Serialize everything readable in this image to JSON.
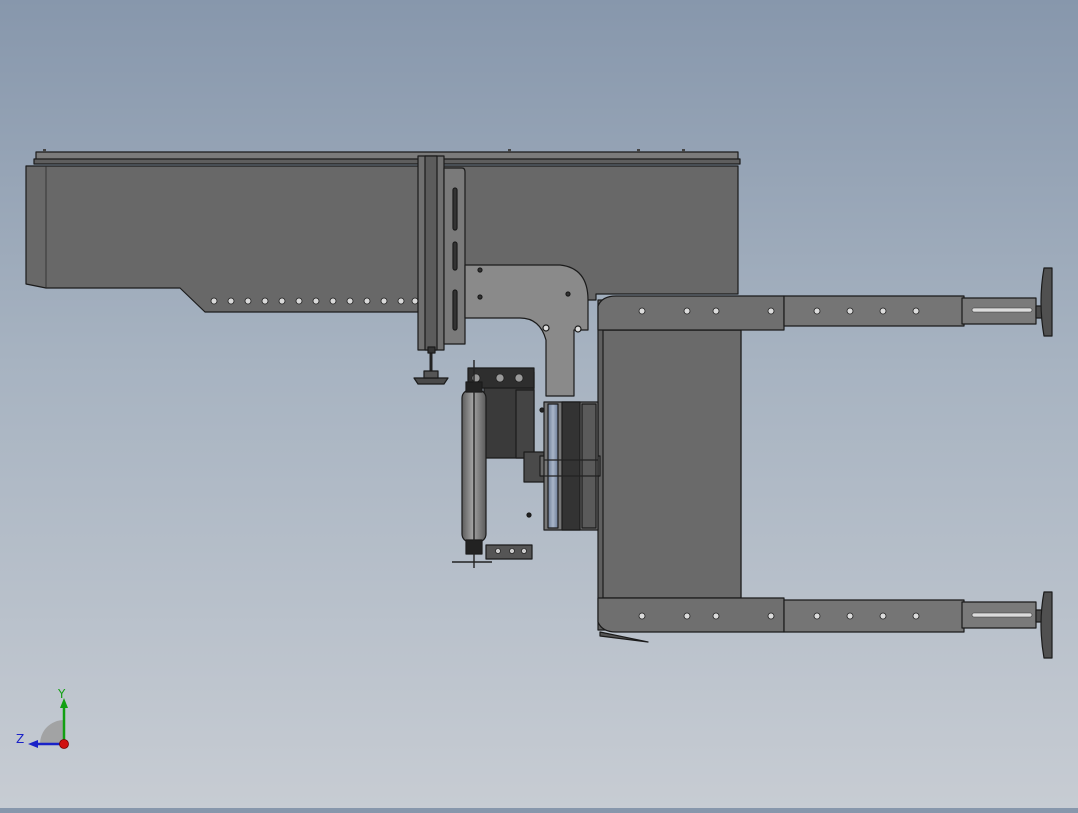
{
  "app": {
    "view": "cad-3d-viewport"
  },
  "model": {
    "name": "conveyor-assembly"
  },
  "triad": {
    "x_label": "",
    "y_label": "Y",
    "z_label": "Z",
    "x_color": "#d01010",
    "y_color": "#12a012",
    "z_color": "#1a22c8"
  },
  "colors": {
    "steel": "#6b6b6b",
    "steel_light": "#858585",
    "steel_dark": "#4e4e4e",
    "edge": "#1b1b1b",
    "roller": "#8a8a8a",
    "pad": "#7f8ea5"
  }
}
